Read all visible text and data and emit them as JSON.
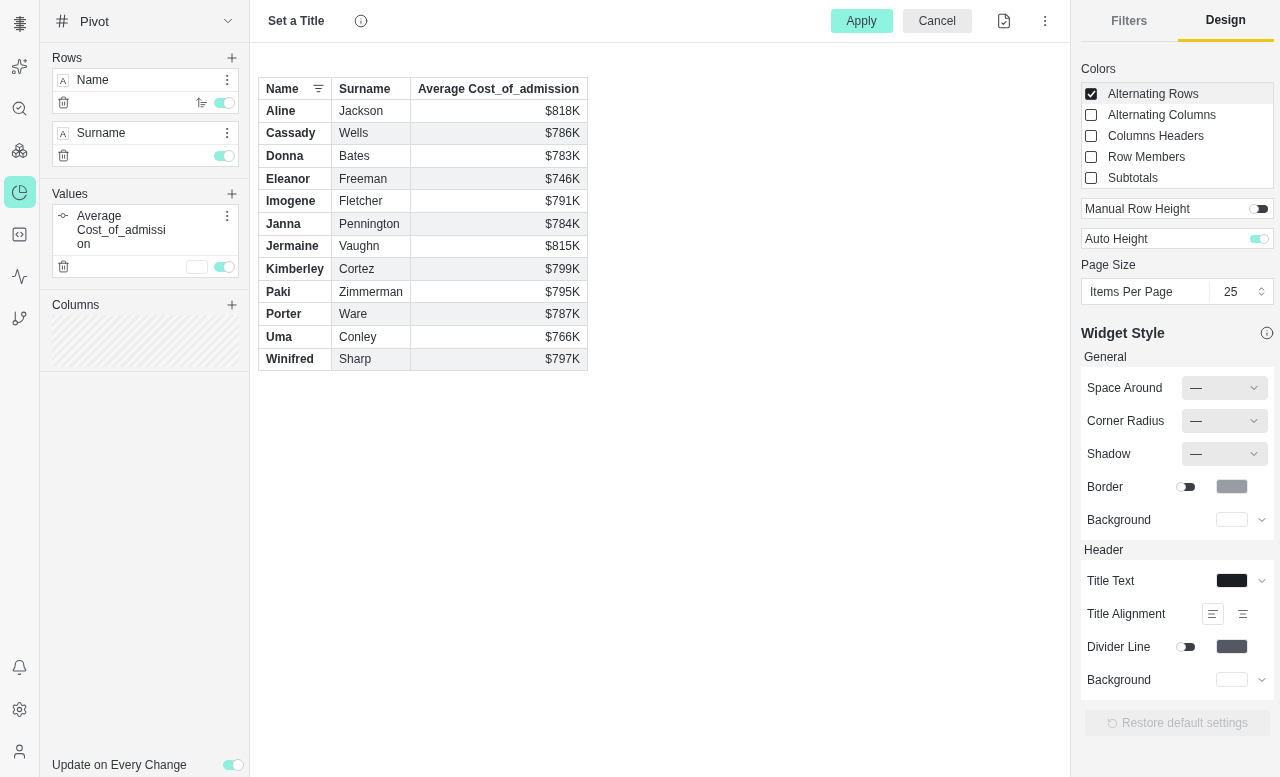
{
  "rail": {
    "top": [
      {
        "selected": false
      },
      {
        "selected": false
      },
      {
        "selected": false
      },
      {
        "selected": true
      },
      {
        "selected": false
      },
      {
        "selected": false
      },
      {
        "selected": false
      }
    ],
    "bottom": [
      {
        "selected": false
      },
      {
        "selected": false
      },
      {
        "selected": false
      }
    ]
  },
  "left_panel": {
    "widget_type": "Pivot",
    "sections": [
      {
        "title": "Rows",
        "fields": [
          {
            "kind": "text",
            "type_label": "A",
            "label": "Name",
            "sorted": true,
            "on": true
          },
          {
            "kind": "text",
            "type_label": "A",
            "label": "Surname",
            "sorted": false,
            "on": true
          }
        ]
      },
      {
        "title": "Values",
        "fields": [
          {
            "kind": "measure",
            "label": "Average Cost_of_admission",
            "sorted": false,
            "on": true
          }
        ]
      },
      {
        "title": "Columns"
      }
    ],
    "update_on_every_change": {
      "label": "Update on Every Change",
      "on": true
    }
  },
  "header": {
    "title": "Set a Title",
    "buttons": [
      {
        "kind": "primary",
        "label": "Apply"
      },
      {
        "kind": "secondary",
        "label": "Cancel"
      }
    ]
  },
  "table": {
    "columns": [
      {
        "label": "Name",
        "sorted": true
      },
      {
        "label": "Surname",
        "sorted": false
      },
      {
        "label": "Average Cost_of_admission",
        "sorted": false
      }
    ],
    "rows": [
      [
        "Aline",
        "Jackson",
        "$818K"
      ],
      [
        "Cassady",
        "Wells",
        "$786K"
      ],
      [
        "Donna",
        "Bates",
        "$783K"
      ],
      [
        "Eleanor",
        "Freeman",
        "$746K"
      ],
      [
        "Imogene",
        "Fletcher",
        "$791K"
      ],
      [
        "Janna",
        "Pennington",
        "$784K"
      ],
      [
        "Jermaine",
        "Vaughn",
        "$815K"
      ],
      [
        "Kimberley",
        "Cortez",
        "$799K"
      ],
      [
        "Paki",
        "Zimmerman",
        "$795K"
      ],
      [
        "Porter",
        "Ware",
        "$787K"
      ],
      [
        "Uma",
        "Conley",
        "$766K"
      ],
      [
        "Winifred",
        "Sharp",
        "$797K"
      ]
    ]
  },
  "right_panel": {
    "tabs": [
      {
        "label": "Filters",
        "selected": false
      },
      {
        "label": "Design",
        "selected": true
      }
    ],
    "colors": {
      "title": "Colors",
      "options": [
        {
          "label": "Alternating Rows",
          "checked": true
        },
        {
          "label": "Alternating Columns",
          "checked": false
        },
        {
          "label": "Columns Headers",
          "checked": false
        },
        {
          "label": "Row Members",
          "checked": false
        },
        {
          "label": "Subtotals",
          "checked": false
        }
      ]
    },
    "toggles": [
      {
        "label": "Manual Row Height",
        "on": false
      },
      {
        "label": "Auto Height",
        "on": true
      }
    ],
    "page_size": {
      "title": "Page Size",
      "label": "Items Per Page",
      "value": "25"
    },
    "widget_style": {
      "title": "Widget Style",
      "groups": [
        {
          "title": "General",
          "rows": [
            {
              "kind": "select",
              "label": "Space Around",
              "value": "—"
            },
            {
              "kind": "select",
              "label": "Corner Radius",
              "value": "—"
            },
            {
              "kind": "select",
              "label": "Shadow",
              "value": "—"
            },
            {
              "kind": "toggle_color",
              "label": "Border",
              "on": false,
              "color": "#9a9ca3"
            },
            {
              "kind": "color_menu",
              "label": "Background",
              "color": "#ffffff"
            }
          ]
        },
        {
          "title": "Header",
          "rows": [
            {
              "kind": "color_menu",
              "label": "Title Text",
              "color": "#1a1d21"
            },
            {
              "kind": "alignment",
              "label": "Title Alignment",
              "options": [
                {
                  "selected": true
                },
                {
                  "selected": false
                }
              ]
            },
            {
              "kind": "toggle_color",
              "label": "Divider Line",
              "on": false,
              "color": "#535862"
            },
            {
              "kind": "color_menu",
              "label": "Background",
              "color": "#ffffff"
            }
          ]
        }
      ]
    },
    "restore": {
      "label": "Restore default settings",
      "disabled": true
    }
  }
}
